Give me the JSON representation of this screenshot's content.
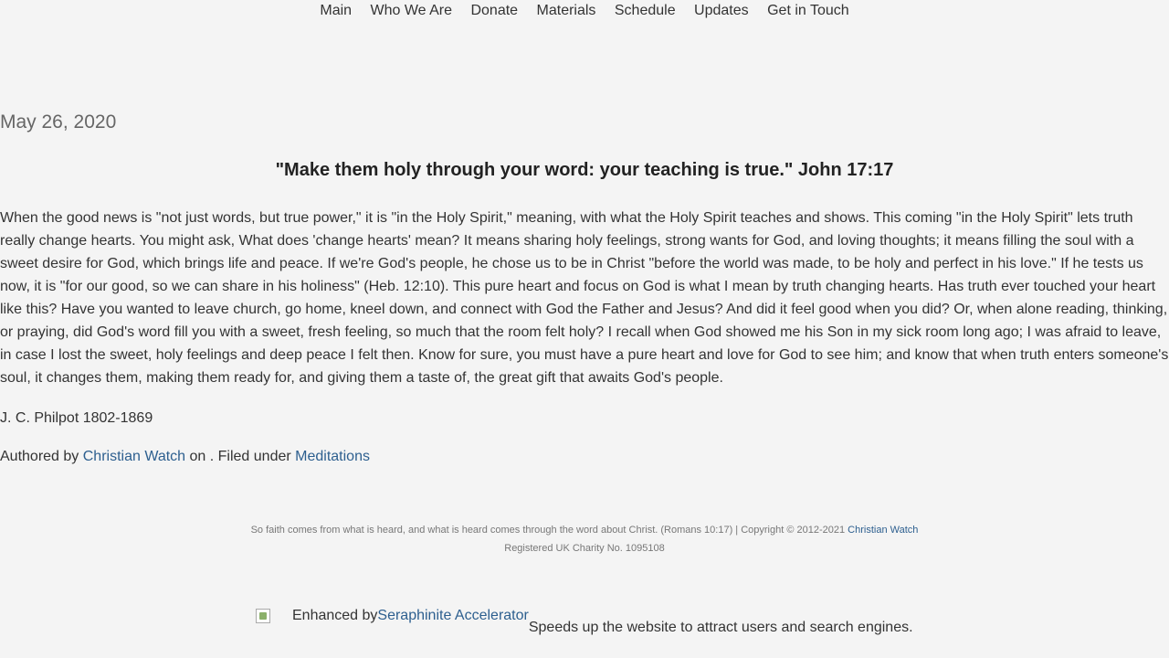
{
  "nav": {
    "items": [
      "Main",
      "Who We Are",
      "Donate",
      "Materials",
      "Schedule",
      "Updates",
      "Get in Touch"
    ]
  },
  "post": {
    "date": "May 26, 2020",
    "verse": "\"Make them holy through your word: your teaching is true.\" John 17:17",
    "body": "When the good news is \"not just words, but true power,\" it is \"in the Holy Spirit,\" meaning, with what the Holy Spirit teaches and shows. This coming \"in the Holy Spirit\" lets truth really change hearts. You might ask, What does 'change hearts' mean? It means sharing holy feelings, strong wants for God, and loving thoughts; it means filling the soul with a sweet desire for God, which brings life and peace. If we're God's people, he chose us to be in Christ \"before the world was made, to be holy and perfect in his love.\" If he tests us now, it is \"for our good, so we can share in his holiness\" (Heb. 12:10). This pure heart and focus on God is what I mean by truth changing hearts. Has truth ever touched your heart like this? Have you wanted to leave church, go home, kneel down, and connect with God the Father and Jesus? And did it feel good when you did? Or, when alone reading, thinking, or praying, did God's word fill you with a sweet, fresh feeling, so much that the room felt holy? I recall when God showed me his Son in my sick room long ago; I was afraid to leave, in case I lost the sweet, holy feelings and deep peace I felt then. Know for sure, you must have a pure heart and love for God to see him; and know that when truth enters someone's soul, it changes them, making them ready for, and giving them a taste of, the great gift that awaits God's people.",
    "author": "J. C. Philpot 1802-1869",
    "meta_prefix": "Authored by ",
    "meta_author": "Christian Watch",
    "meta_middle": " on . Filed under ",
    "meta_category": "Meditations"
  },
  "footer": {
    "line1_text": "So faith comes from what is heard, and what is heard comes through the word about Christ. (Romans 10:17) | Copyright © 2012-2021 ",
    "line1_link": "Christian Watch",
    "line2": "Registered UK Charity No. 1095108"
  },
  "accelerator": {
    "prefix": "Enhanced by",
    "link": "Seraphinite Accelerator",
    "desc": "Speeds up the website to attract users and search engines."
  }
}
